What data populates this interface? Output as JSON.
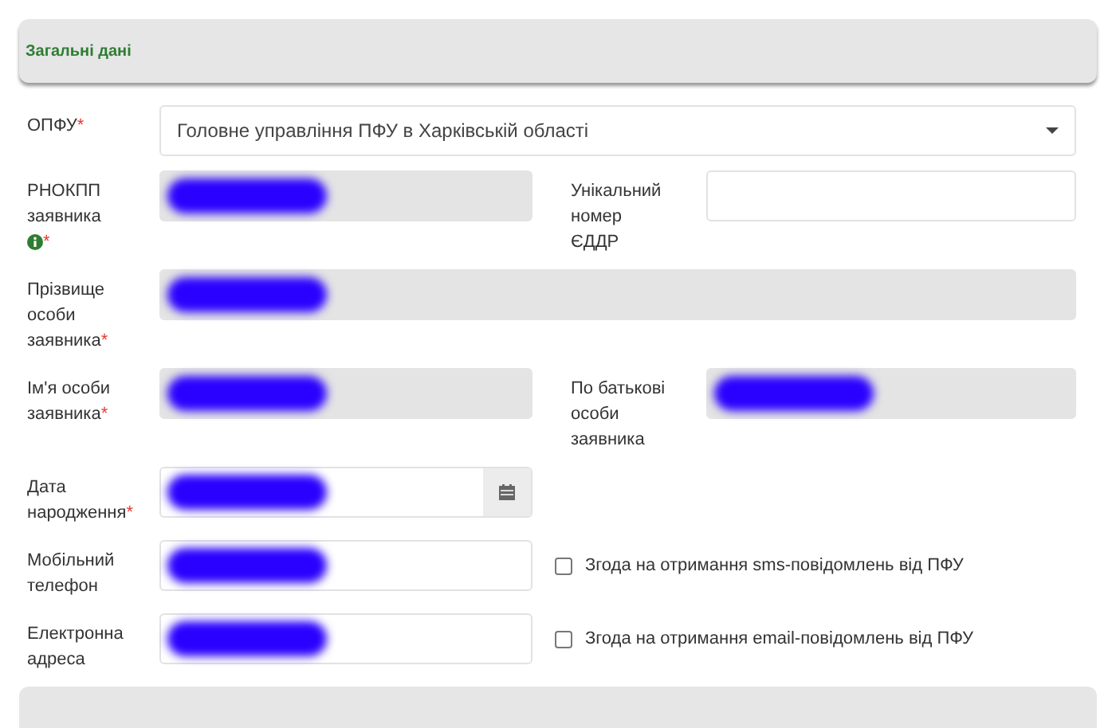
{
  "section_title": "Загальні дані",
  "rows": [
    {
      "left": {
        "kind": "select",
        "label": "ОПФУ",
        "required_mark": "*",
        "value": "Головне управління ПФУ в Харківській області",
        "wide": true
      }
    },
    {
      "left": {
        "kind": "text",
        "label": "РНОКПП заявника",
        "info": true,
        "required_mark": "*",
        "readonly": true,
        "redacted": true
      },
      "right": {
        "kind": "text",
        "label": "Унікальний номер ЄДДР",
        "readonly": false,
        "redacted": false
      }
    },
    {
      "left": {
        "kind": "text",
        "label": "Прізвище особи заявника",
        "required_mark": "*",
        "readonly": true,
        "redacted": true,
        "wide": true
      }
    },
    {
      "left": {
        "kind": "text",
        "label": "Ім'я особи заявника",
        "required_mark": "*",
        "readonly": true,
        "redacted": true
      },
      "right": {
        "kind": "text",
        "label": "По батькові особи заявника",
        "readonly": true,
        "redacted": true
      }
    },
    {
      "left": {
        "kind": "date",
        "label": "Дата народження",
        "required_mark": "*",
        "readonly": false,
        "redacted": true
      }
    },
    {
      "left": {
        "kind": "text",
        "label": "Мобільний телефон",
        "readonly": false,
        "redacted": true
      },
      "right": {
        "kind": "checkbox",
        "label": "Згода на отримання sms-повідомлень від ПФУ",
        "checked": false
      }
    },
    {
      "left": {
        "kind": "text",
        "label": "Електронна адреса",
        "readonly": false,
        "redacted": true
      },
      "right": {
        "kind": "checkbox",
        "label": "Згода на отримання email-повідомлень від ПФУ",
        "checked": false
      }
    }
  ]
}
